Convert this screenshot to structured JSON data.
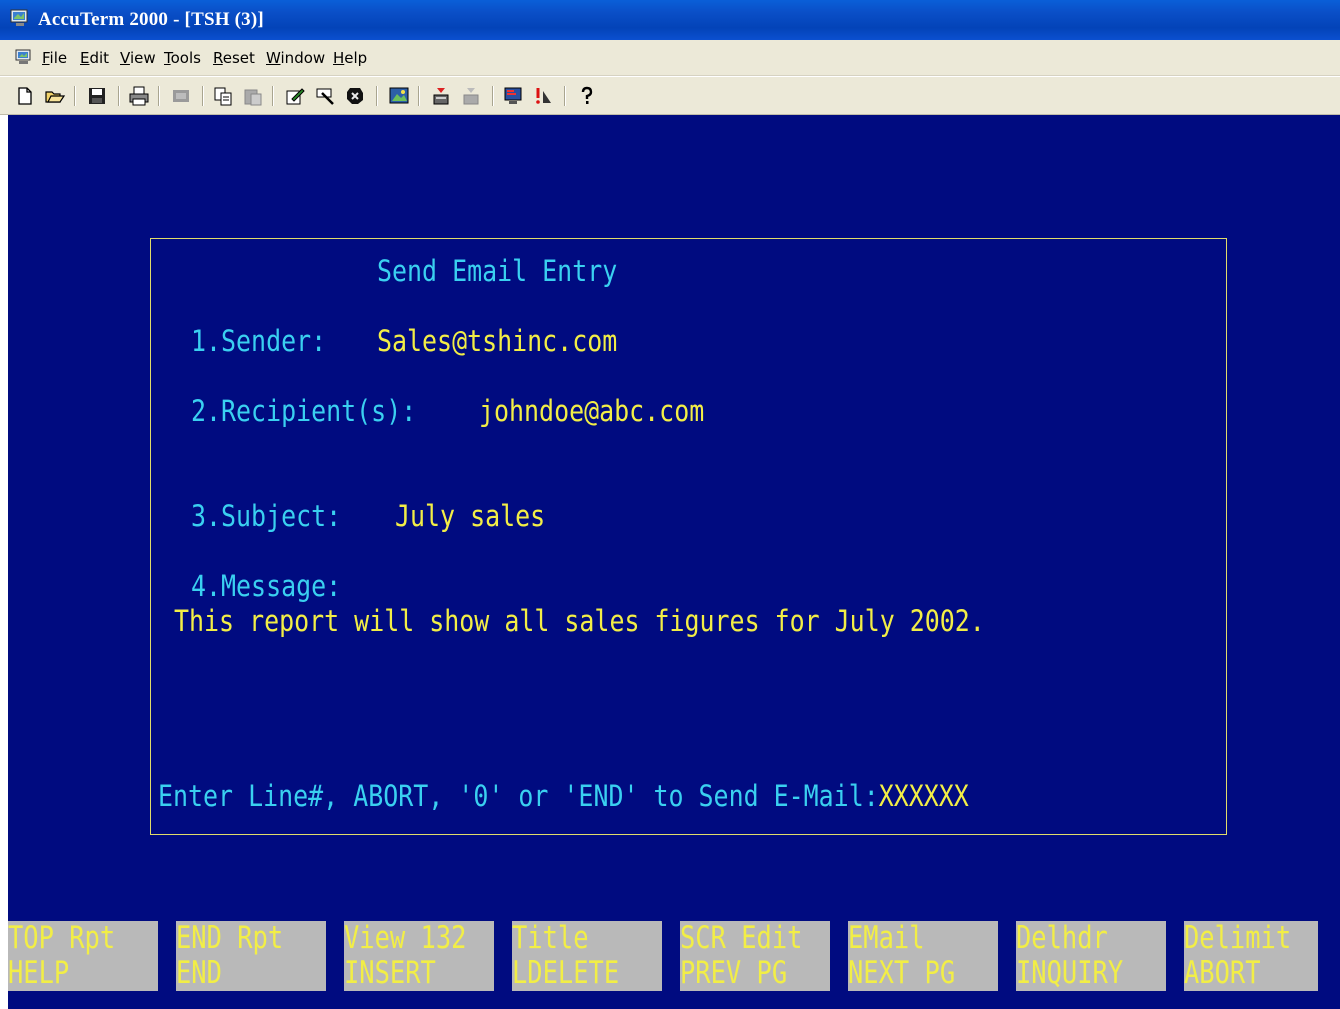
{
  "window": {
    "title": "AccuTerm 2000 - [TSH (3)]"
  },
  "menu": {
    "items": [
      "File",
      "Edit",
      "View",
      "Tools",
      "Reset",
      "Window",
      "Help"
    ]
  },
  "toolbar": {
    "buttons": [
      "new-icon",
      "open-icon",
      "save-icon",
      "print-icon",
      "disabled-icon",
      "copy-icon",
      "paste-icon",
      "edit-icon",
      "find-icon",
      "stop-icon",
      "image-icon",
      "upload-icon",
      "download-icon",
      "monitor-icon",
      "alert-icon",
      "help-icon"
    ]
  },
  "colors": {
    "terminal_bg": "#000b80",
    "label": "#3ad0f0",
    "value": "#f2ee46",
    "fkey_bg": "#b9b9b9",
    "titlebar": "#0a4fc8"
  },
  "form": {
    "title": "Send Email Entry",
    "sender_label": "1.Sender:",
    "sender_value": "Sales@tshinc.com",
    "recipient_label": "2.Recipient(s):",
    "recipient_value": "johndoe@abc.com",
    "subject_label": "3.Subject:",
    "subject_value": "July sales",
    "message_label": "4.Message:",
    "message_value": "This report will show all sales figures for July 2002.",
    "prompt": "Enter Line#, ABORT, '0' or 'END' to Send E-Mail:",
    "prompt_input": "XXXXXX"
  },
  "function_keys": [
    {
      "top": "TOP Rpt",
      "bottom": "HELP"
    },
    {
      "top": "END Rpt",
      "bottom": "END"
    },
    {
      "top": "View 132",
      "bottom": "INSERT"
    },
    {
      "top": "Title",
      "bottom": "LDELETE"
    },
    {
      "top": "SCR Edit",
      "bottom": "PREV PG"
    },
    {
      "top": "EMail",
      "bottom": "NEXT PG"
    },
    {
      "top": "Delhdr",
      "bottom": "INQUIRY"
    },
    {
      "top": "Delimit",
      "bottom": "ABORT"
    }
  ]
}
